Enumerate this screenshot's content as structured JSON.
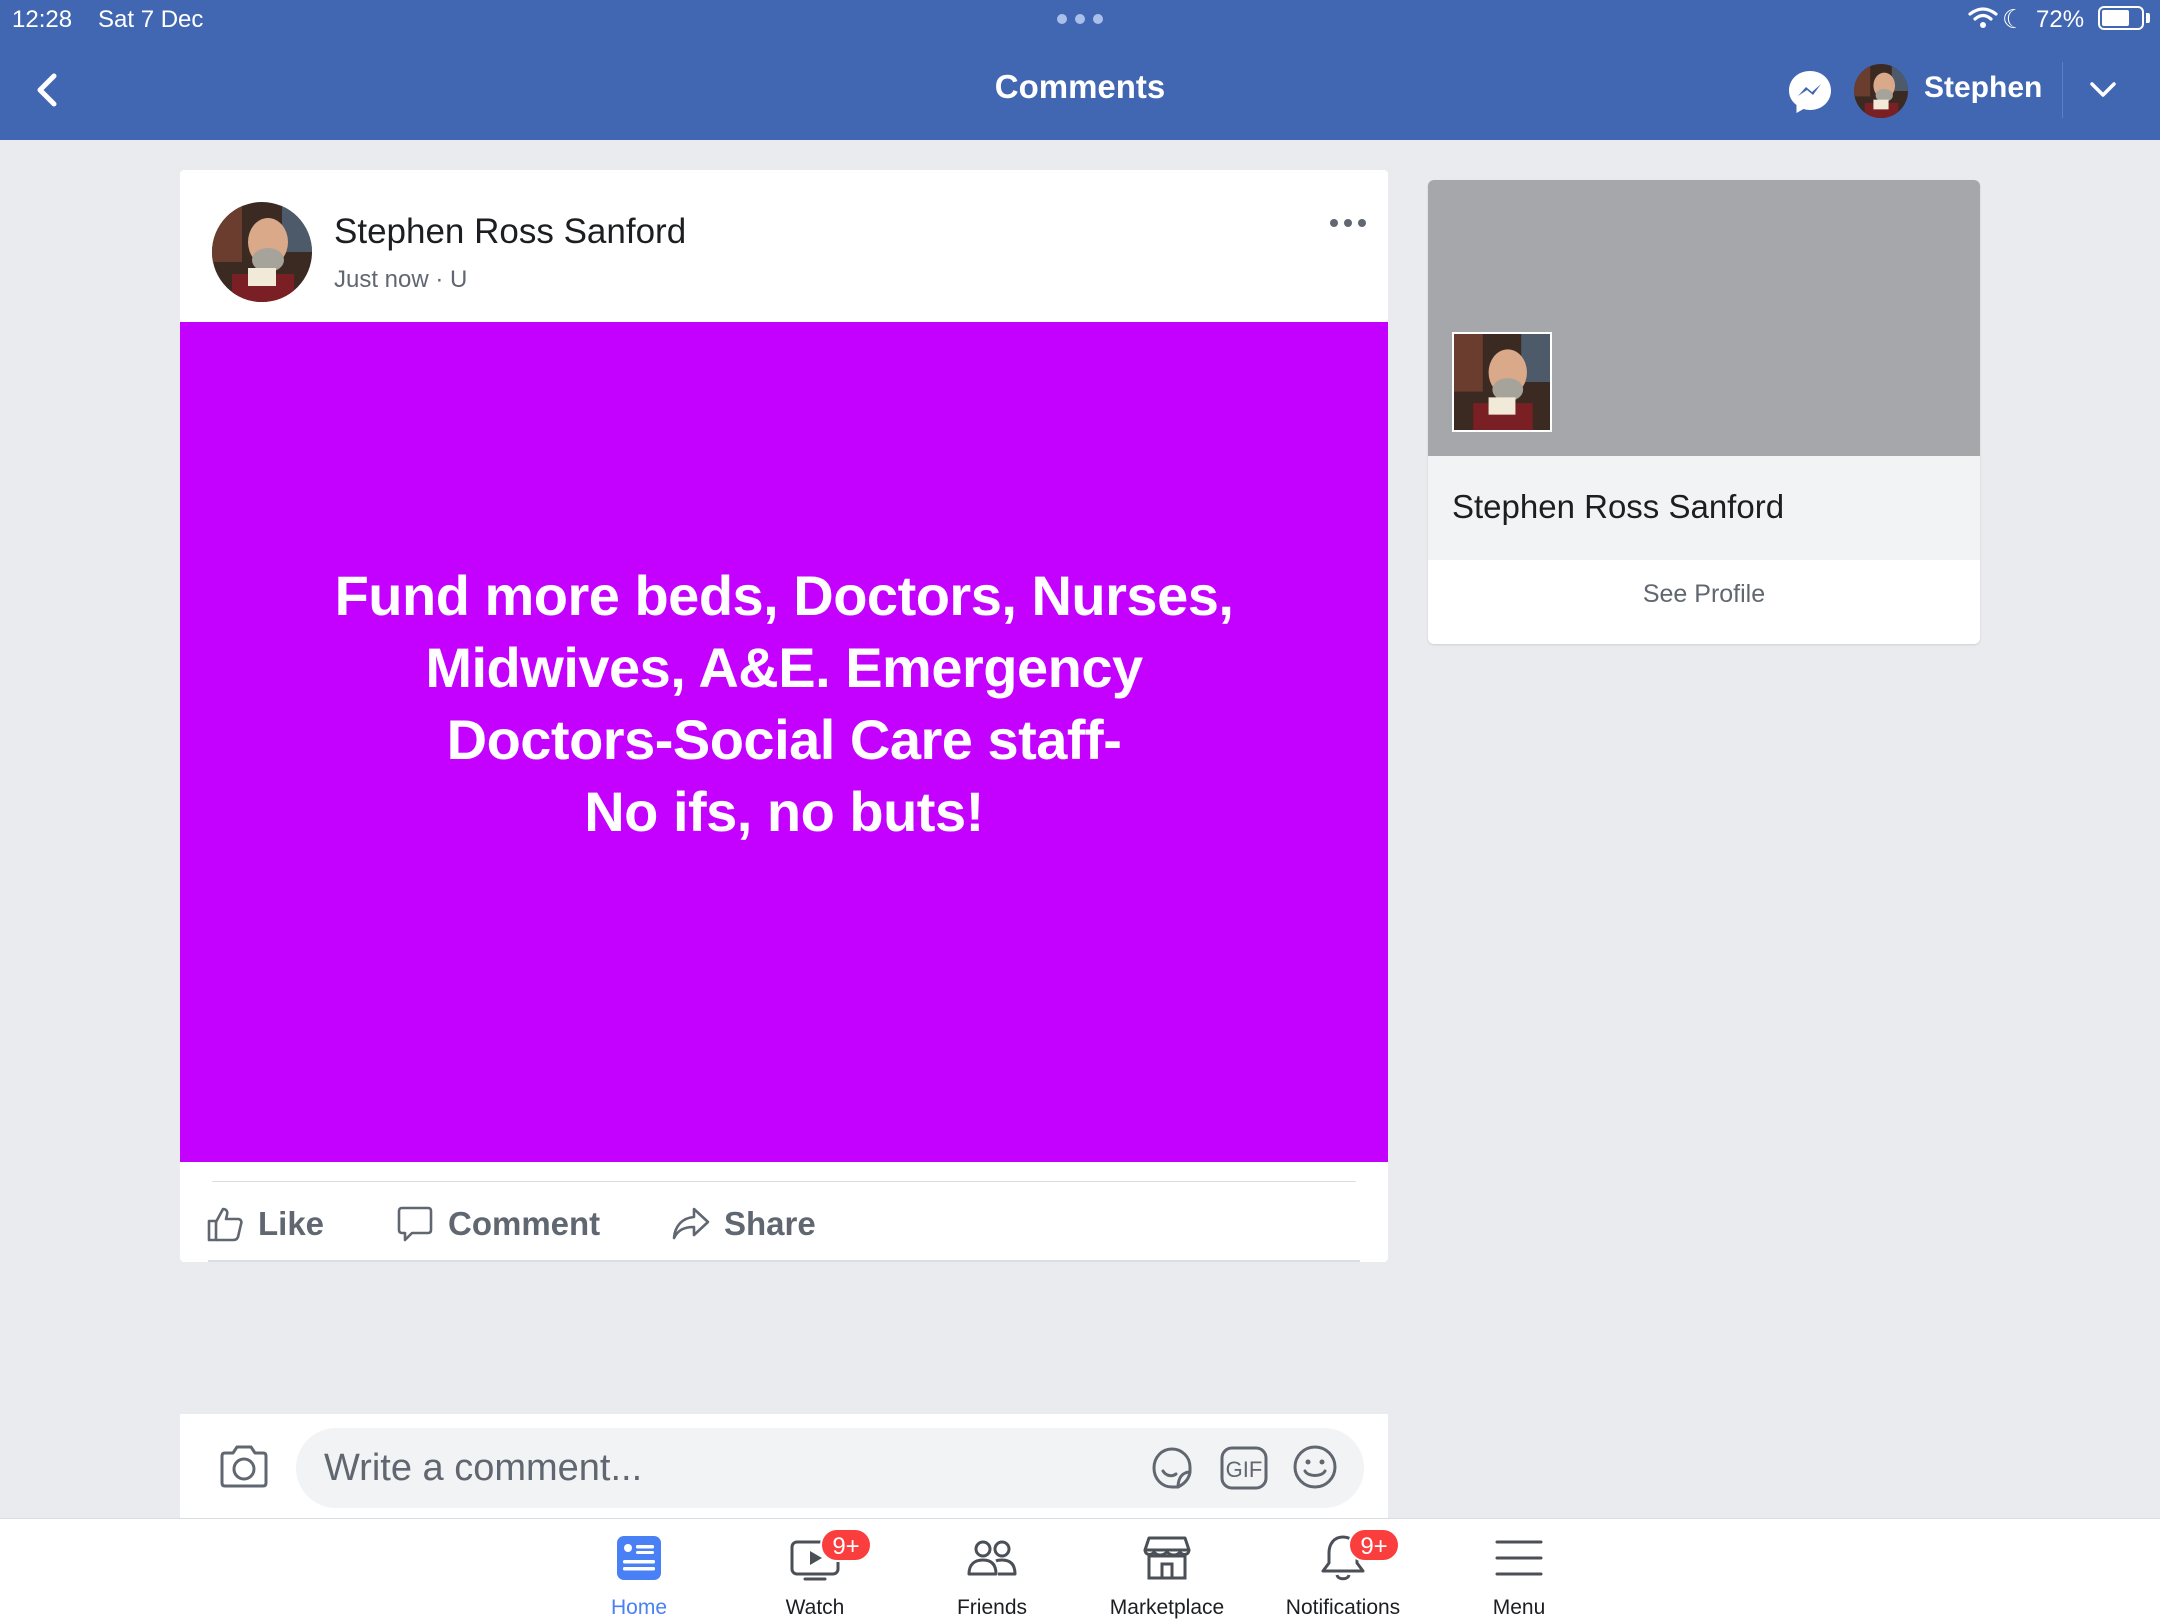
{
  "status_bar": {
    "time": "12:28",
    "date": "Sat 7 Dec",
    "battery": "72%",
    "battery_level": 0.72
  },
  "header": {
    "title": "Comments",
    "username": "Stephen"
  },
  "post": {
    "author": "Stephen Ross Sanford",
    "meta": "Just now · U",
    "text": "Fund more beds, Doctors, Nurses,\nMidwives, A&E. Emergency\nDoctors-Social Care staff-\nNo ifs, no buts!",
    "background_color": "#c400ff",
    "actions": {
      "like": "Like",
      "comment": "Comment",
      "share": "Share"
    }
  },
  "profile_card": {
    "name": "Stephen Ross Sanford",
    "see_profile": "See Profile"
  },
  "composer": {
    "placeholder": "Write a comment...",
    "gif": "GIF"
  },
  "tabs": [
    {
      "label": "Home",
      "icon": "home-icon",
      "active": true
    },
    {
      "label": "Watch",
      "icon": "watch-icon",
      "badge": "9+"
    },
    {
      "label": "Friends",
      "icon": "friends-icon"
    },
    {
      "label": "Marketplace",
      "icon": "marketplace-icon"
    },
    {
      "label": "Notifications",
      "icon": "bell-icon",
      "badge": "9+"
    },
    {
      "label": "Menu",
      "icon": "menu-icon"
    }
  ],
  "colors": {
    "brand_blue": "#4267b2",
    "active_tab": "#4a80f5",
    "badge_red": "#fa3e3e"
  }
}
